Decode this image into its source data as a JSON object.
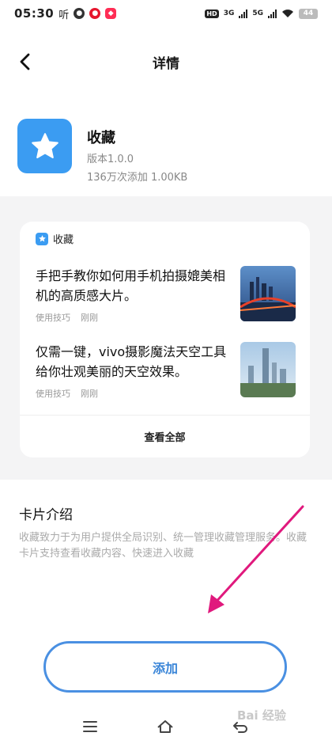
{
  "status_bar": {
    "time": "05:30",
    "ting": "听",
    "hd": "HD",
    "net1": "3G",
    "net2": "5G",
    "battery": "44"
  },
  "nav": {
    "title": "详情"
  },
  "app": {
    "name": "收藏",
    "version": "版本1.0.0",
    "meta": "136万次添加 1.00KB",
    "accent": "#3b9cf2"
  },
  "card": {
    "header_label": "收藏",
    "articles": [
      {
        "title": "手把手教你如何用手机拍摄媲美相机的高质感大片。",
        "category": "使用技巧",
        "time": "刚刚"
      },
      {
        "title": "仅需一键，vivo摄影魔法天空工具给你壮观美丽的天空效果。",
        "category": "使用技巧",
        "time": "刚刚"
      }
    ],
    "view_all": "查看全部"
  },
  "intro": {
    "title": "卡片介绍",
    "text": "收藏致力于为用户提供全局识别、统一管理收藏管理服务。收藏卡片支持查看收藏内容、快速进入收藏"
  },
  "add_button": {
    "label": "添加",
    "color": "#4a90e2"
  },
  "arrow_color": "#e0197d",
  "watermark": "Bai 经验"
}
